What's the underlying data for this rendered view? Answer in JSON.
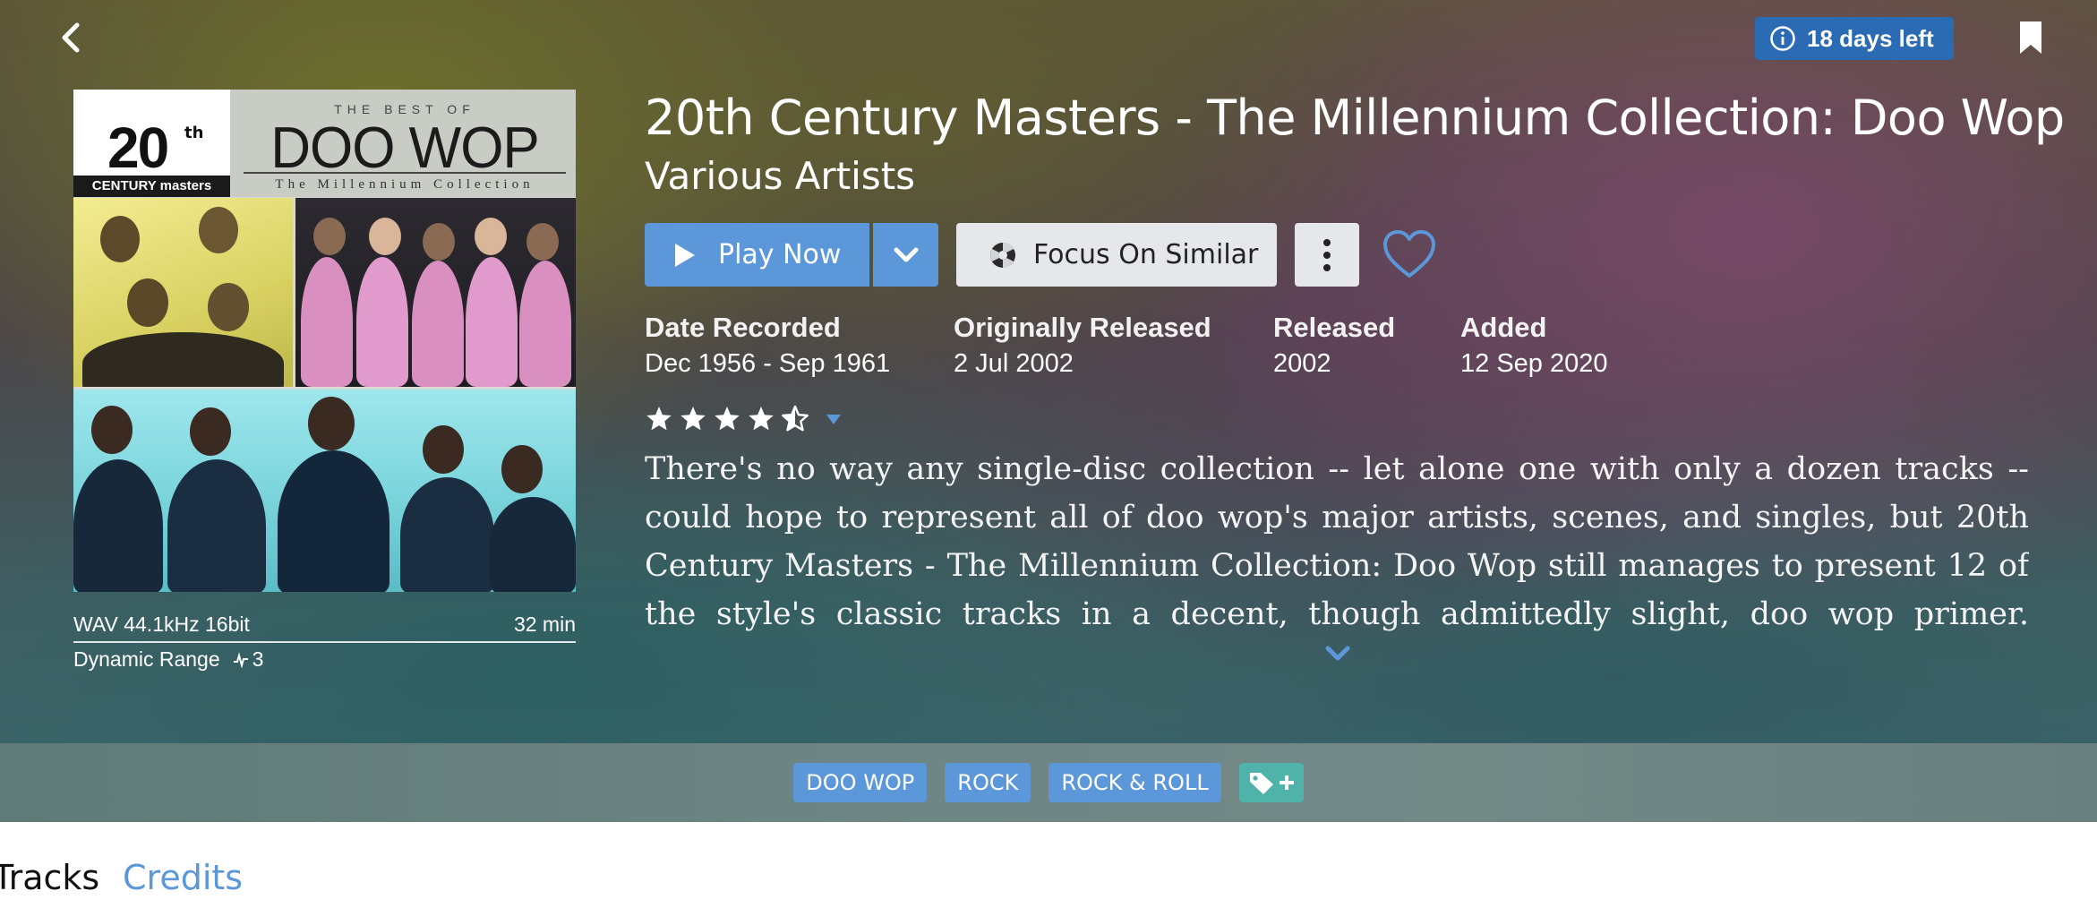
{
  "header": {
    "trial_badge": "18 days left",
    "icons": {
      "back": "chevron-left-icon",
      "info": "info-icon",
      "bookmark": "bookmark-icon"
    }
  },
  "album": {
    "title": "20th Century Masters - The Millennium Collection: Doo Wop",
    "artist": "Various Artists",
    "cover": {
      "logo_number": "20",
      "logo_suffix": "th",
      "logo_caption": "CENTURY masters",
      "best_of": "THE BEST OF",
      "cover_title": "DOO WOP",
      "cover_subtitle": "The Millennium Collection"
    },
    "format": "WAV 44.1kHz 16bit",
    "duration": "32 min",
    "dynamic_range_label": "Dynamic Range",
    "dynamic_range_value": "3"
  },
  "actions": {
    "play": "Play Now",
    "focus": "Focus On Similar"
  },
  "dates": [
    {
      "label": "Date Recorded",
      "value": "Dec 1956 - Sep 1961"
    },
    {
      "label": "Originally Released",
      "value": "2 Jul 2002"
    },
    {
      "label": "Released",
      "value": "2002"
    },
    {
      "label": "Added",
      "value": "12 Sep 2020"
    }
  ],
  "rating": {
    "stars": 4.5,
    "max": 5
  },
  "review": "There's no way any single-disc collection -- let alone one with only a dozen tracks -- could hope to represent all of doo wop's major artists, scenes, and singles, but 20th Century Masters - The Millennium Collection: Doo Wop still manages to present 12 of the style's classic tracks in a decent, though admittedly slight, doo wop primer. Though it necessarily",
  "tags": [
    "DOO WOP",
    "ROCK",
    "ROCK & ROLL"
  ],
  "tabs": {
    "tracks": "Tracks",
    "credits": "Credits"
  },
  "colors": {
    "accent": "#5b97d9",
    "badge": "#2b6bb3",
    "tag_add": "#4fb3a9",
    "button_light": "#e6e7ea"
  }
}
